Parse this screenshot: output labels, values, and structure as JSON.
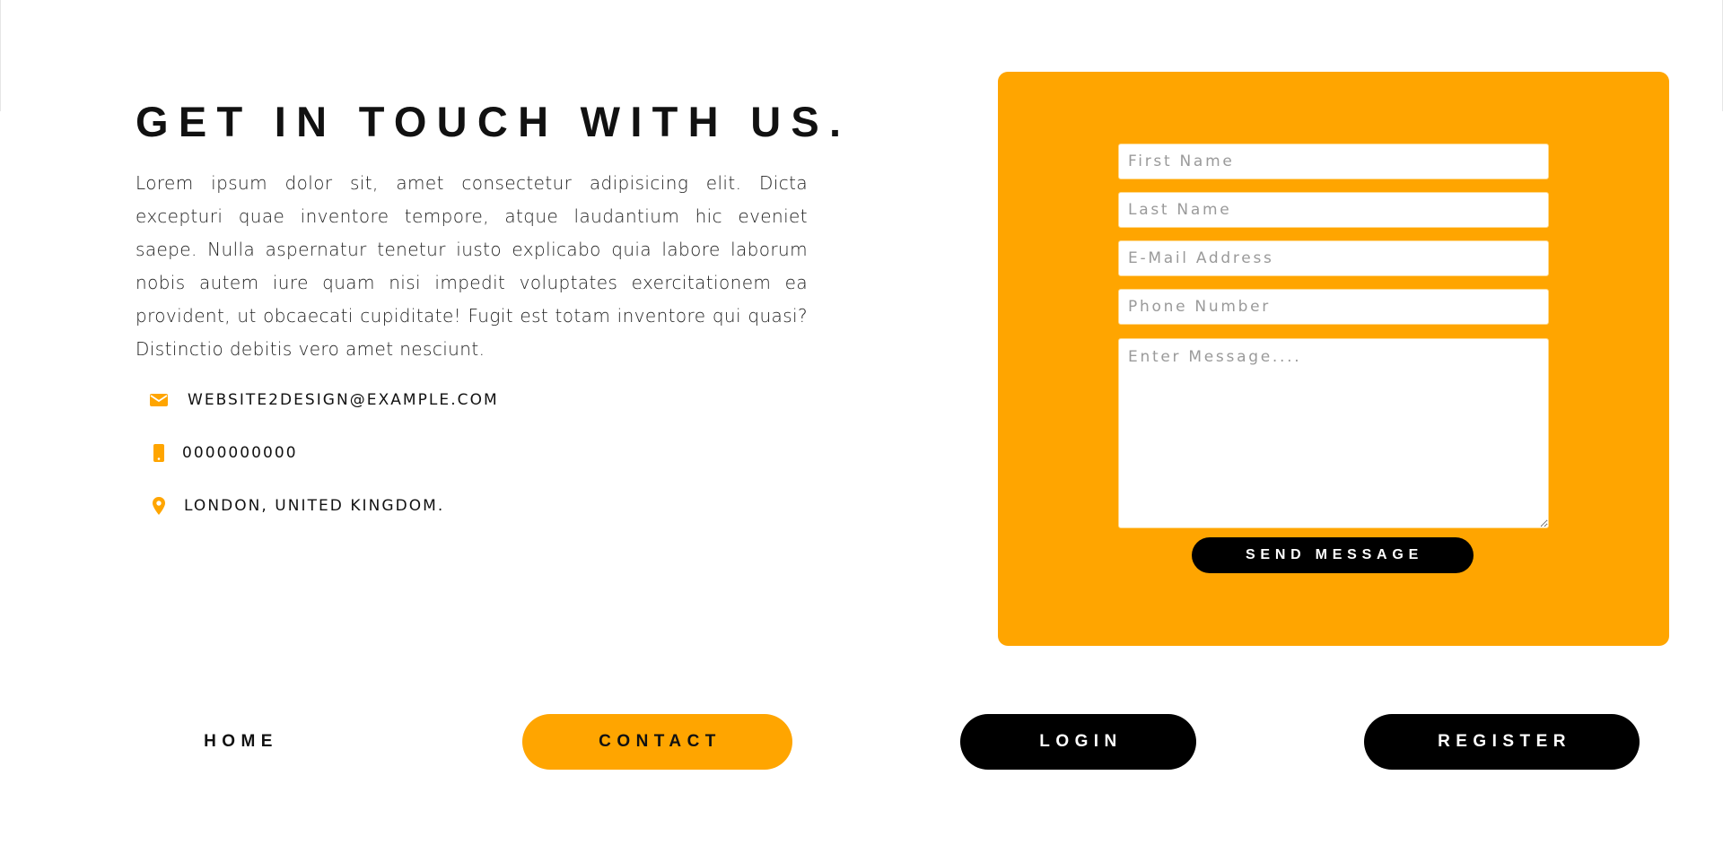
{
  "colors": {
    "accent": "#ffa500",
    "button_dark": "#000000",
    "background": "#ffffff",
    "text": "#111111"
  },
  "contact_section": {
    "title": "GET IN TOUCH WITH US.",
    "description": "Lorem ipsum dolor sit, amet consectetur adipisicing elit. Dicta excepturi quae inventore tempore, atque laudantium hic eveniet saepe. Nulla aspernatur tenetur iusto explicabo quia labore laborum nobis autem iure quam nisi impedit voluptates exercitationem ea provident, ut obcaecati cupiditate! Fugit est totam inventore qui quasi? Distinctio debitis vero amet nesciunt.",
    "items": [
      {
        "icon": "envelope-icon",
        "text": "WEBSITE2DESIGN@EXAMPLE.COM"
      },
      {
        "icon": "mobile-phone-icon",
        "text": "0000000000"
      },
      {
        "icon": "map-pin-icon",
        "text": "LONDON, UNITED KINGDOM."
      }
    ]
  },
  "form": {
    "first_name": {
      "placeholder": "First Name",
      "value": ""
    },
    "last_name": {
      "placeholder": "Last Name",
      "value": ""
    },
    "email": {
      "placeholder": "E-Mail Address",
      "value": ""
    },
    "phone": {
      "placeholder": "Phone Number",
      "value": ""
    },
    "message": {
      "placeholder": "Enter Message....",
      "value": ""
    },
    "submit_label": "SEND MESSAGE"
  },
  "nav": {
    "home": "HOME",
    "contact": "CONTACT",
    "login": "LOGIN",
    "register": "REGISTER",
    "active": "contact"
  }
}
